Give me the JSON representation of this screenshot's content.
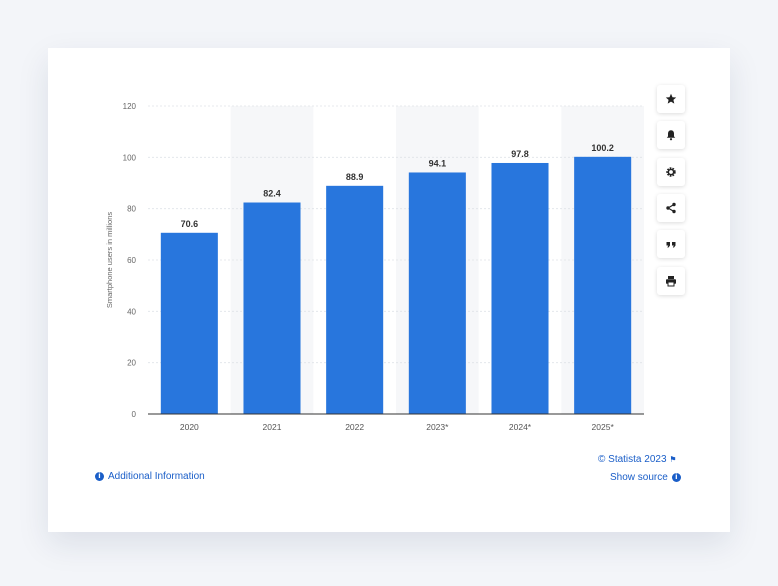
{
  "chart_data": {
    "type": "bar",
    "categories": [
      "2020",
      "2021",
      "2022",
      "2023*",
      "2024*",
      "2025*"
    ],
    "values": [
      70.6,
      82.4,
      88.9,
      94.1,
      97.8,
      100.2
    ],
    "value_labels": [
      "70.6",
      "82.4",
      "88.9",
      "94.1",
      "97.8",
      "100.2"
    ],
    "ylabel": "Smartphone users in millions",
    "ylim": [
      0,
      120
    ],
    "yticks": [
      0,
      20,
      40,
      60,
      80,
      100,
      120
    ],
    "grid": true,
    "bar_color": "#2876dd"
  },
  "toolbar": {
    "items": [
      {
        "name": "star-icon",
        "label": "Favorite"
      },
      {
        "name": "bell-icon",
        "label": "Notification"
      },
      {
        "name": "gear-icon",
        "label": "Settings"
      },
      {
        "name": "share-icon",
        "label": "Share"
      },
      {
        "name": "quote-icon",
        "label": "Cite"
      },
      {
        "name": "print-icon",
        "label": "Print"
      }
    ]
  },
  "footer": {
    "additional_info": "Additional Information",
    "copyright": "© Statista 2023",
    "show_source": "Show source"
  },
  "colors": {
    "accent": "#1a5ec8",
    "page_bg": "#f3f5f9"
  }
}
